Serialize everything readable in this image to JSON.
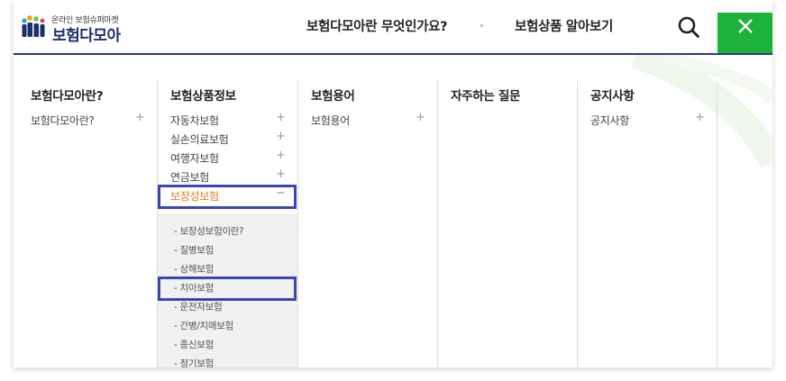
{
  "header": {
    "logo_tagline": "온라인 보험슈퍼마켓",
    "logo_name": "보험다모아",
    "nav": [
      {
        "label": "보험다모아란 무엇인가요?"
      },
      {
        "label": "보험상품 알아보기"
      }
    ],
    "search_icon": "search-icon",
    "close_icon": "close-icon"
  },
  "colors": {
    "accent_green": "#1db33a",
    "navy": "#2a3a80",
    "highlight_box": "#3a46b8",
    "active_item": "#e07b1f"
  },
  "menu": {
    "columns": [
      {
        "title": "보험다모아란?",
        "items": [
          {
            "label": "보험다모아란?",
            "toggle": "+"
          }
        ]
      },
      {
        "title": "보험상품정보",
        "items": [
          {
            "label": "자동차보험",
            "toggle": "+"
          },
          {
            "label": "실손의료보험",
            "toggle": "+"
          },
          {
            "label": "여행자보험",
            "toggle": "+"
          },
          {
            "label": "연금보험",
            "toggle": "+"
          },
          {
            "label": "보장성보험",
            "toggle": "−",
            "active": true
          }
        ],
        "submenu": [
          {
            "label": "- 보장성보험이란?"
          },
          {
            "label": "- 질병보험"
          },
          {
            "label": "- 상해보험"
          },
          {
            "label": "- 치아보험"
          },
          {
            "label": "- 운전자보험"
          },
          {
            "label": "- 간병/치매보험"
          },
          {
            "label": "- 종신보험"
          },
          {
            "label": "- 정기보험"
          }
        ]
      },
      {
        "title": "보험용어",
        "items": [
          {
            "label": "보험용어",
            "toggle": "+"
          }
        ]
      },
      {
        "title": "자주하는 질문",
        "items": []
      },
      {
        "title": "공지사항",
        "items": [
          {
            "label": "공지사항",
            "toggle": "+"
          }
        ]
      }
    ]
  }
}
